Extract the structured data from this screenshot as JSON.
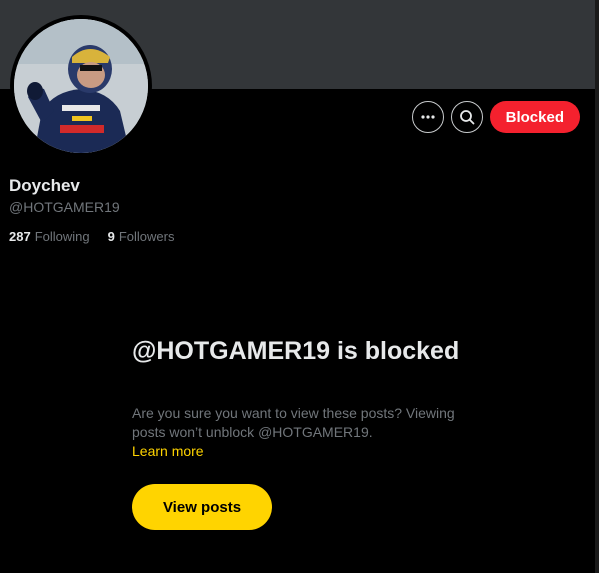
{
  "profile": {
    "name": "Doychev",
    "handle": "@HOTGAMER19",
    "following_count": "287",
    "following_label": "Following",
    "followers_count": "9",
    "followers_label": "Followers"
  },
  "actions": {
    "more_icon": "more-icon",
    "search_icon": "search-icon",
    "blocked_label": "Blocked"
  },
  "blocked_notice": {
    "title": "@HOTGAMER19 is blocked",
    "text": "Are you sure you want to view these posts? Viewing posts won’t unblock @HOTGAMER19.",
    "learn_more": "Learn more",
    "view_posts": "View posts"
  },
  "colors": {
    "background": "#000000",
    "banner": "#333639",
    "blocked_red": "#f4212e",
    "accent_yellow": "#ffd400",
    "secondary_text": "#71767b"
  }
}
